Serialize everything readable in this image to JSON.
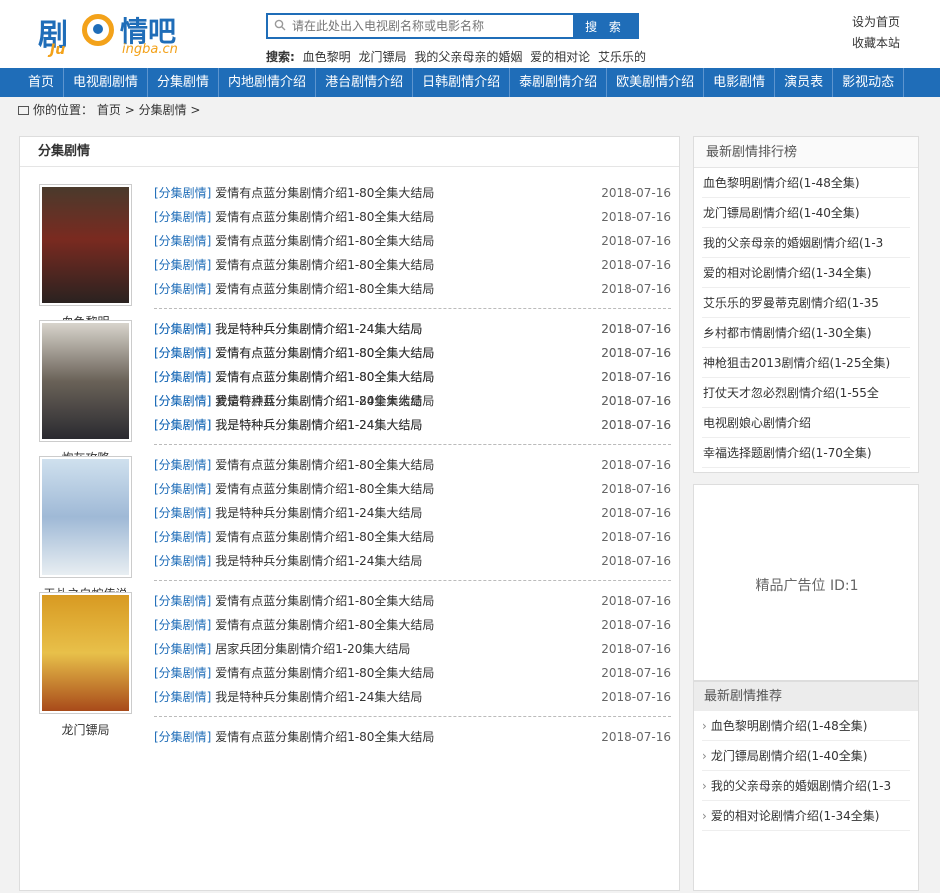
{
  "logo": {
    "char1": "剧",
    "char2": "情吧",
    "sub1": "Ju",
    "sub2": "ingba.cn"
  },
  "search": {
    "placeholder": "请在此处出入电视剧名称或电影名称",
    "button": "搜 索"
  },
  "hot": {
    "label": "搜索:",
    "items": [
      "血色黎明",
      "龙门镖局",
      "我的父亲母亲的婚姻",
      "爱的相对论",
      "艾乐乐的"
    ]
  },
  "toplinks": {
    "home": "设为首页",
    "fav": "收藏本站"
  },
  "nav": [
    "首页",
    "电视剧剧情",
    "分集剧情",
    "内地剧情介绍",
    "港台剧情介绍",
    "日韩剧情介绍",
    "泰剧剧情介绍",
    "欧美剧情介绍",
    "电影剧情",
    "演员表",
    "影视动态"
  ],
  "crumb": {
    "label": "你的位置：",
    "home": "首页",
    "sep": ">",
    "cur": "分集剧情",
    "end": ">"
  },
  "main": {
    "title": "分集剧情",
    "cat": "[分集剧情]",
    "groups": [
      {
        "name": "血色黎明",
        "rows": [
          {
            "t": "爱情有点蓝分集剧情介绍1-80全集大结局",
            "d": "2018-07-16"
          },
          {
            "t": "爱情有点蓝分集剧情介绍1-80全集大结局",
            "d": "2018-07-16"
          },
          {
            "t": "爱情有点蓝分集剧情介绍1-80全集大结局",
            "d": "2018-07-16"
          },
          {
            "t": "爱情有点蓝分集剧情介绍1-80全集大结局",
            "d": "2018-07-16"
          },
          {
            "t": "爱情有点蓝分集剧情介绍1-80全集大结局",
            "d": "2018-07-16"
          },
          {
            "t": "我是特种兵分集剧情介绍1-24集大结局",
            "d": "2018-07-16"
          },
          {
            "t": "爱情有点蓝分集剧情介绍1-80全集大结局",
            "d": "2018-07-16"
          },
          {
            "t": "爱情有点蓝分集剧情介绍1-80全集大结局",
            "d": "2018-07-16"
          },
          {
            "t": "爱情有点蓝分集剧情介绍1-80全集大结局",
            "d": "2018-07-16"
          },
          {
            "t": "我是特种兵分集剧情介绍1-24集大结局",
            "d": "2018-07-16"
          }
        ]
      },
      {
        "name": "炮灰攻略",
        "rows": [
          {
            "t": "我是特种兵分集剧情介绍1-24集大结局",
            "d": "2018-07-16"
          },
          {
            "t": "爱情有点蓝分集剧情介绍1-80全集大结局",
            "d": "2018-07-16"
          },
          {
            "t": "爱情有点蓝分集剧情介绍1-80全集大结局",
            "d": "2018-07-16"
          },
          {
            "t": "我是特种兵分集剧情介绍1-24集大结局",
            "d": "2018-07-16"
          },
          {
            "t": "我是特种兵分集剧情介绍1-24集大结局",
            "d": "2018-07-16"
          }
        ]
      },
      {
        "name": "天乩之白蛇传说",
        "rows": [
          {
            "t": "爱情有点蓝分集剧情介绍1-80全集大结局",
            "d": "2018-07-16"
          },
          {
            "t": "爱情有点蓝分集剧情介绍1-80全集大结局",
            "d": "2018-07-16"
          },
          {
            "t": "我是特种兵分集剧情介绍1-24集大结局",
            "d": "2018-07-16"
          },
          {
            "t": "爱情有点蓝分集剧情介绍1-80全集大结局",
            "d": "2018-07-16"
          },
          {
            "t": "我是特种兵分集剧情介绍1-24集大结局",
            "d": "2018-07-16"
          }
        ]
      },
      {
        "name": "龙门镖局",
        "rows": [
          {
            "t": "爱情有点蓝分集剧情介绍1-80全集大结局",
            "d": "2018-07-16"
          },
          {
            "t": "爱情有点蓝分集剧情介绍1-80全集大结局",
            "d": "2018-07-16"
          },
          {
            "t": "居家兵团分集剧情介绍1-20集大结局",
            "d": "2018-07-16"
          },
          {
            "t": "爱情有点蓝分集剧情介绍1-80全集大结局",
            "d": "2018-07-16"
          },
          {
            "t": "我是特种兵分集剧情介绍1-24集大结局",
            "d": "2018-07-16"
          },
          {
            "t": "爱情有点蓝分集剧情介绍1-80全集大结局",
            "d": "2018-07-16"
          }
        ]
      }
    ]
  },
  "rank": {
    "title": "最新剧情排行榜",
    "items": [
      "血色黎明剧情介绍(1-48全集)",
      "龙门镖局剧情介绍(1-40全集)",
      "我的父亲母亲的婚姻剧情介绍(1-3",
      "爱的相对论剧情介绍(1-34全集)",
      "艾乐乐的罗曼蒂克剧情介绍(1-35",
      "乡村都市情剧情介绍(1-30全集)",
      "神枪狙击2013剧情介绍(1-25全集)",
      "打仗天才忽必烈剧情介绍(1-55全",
      "电视剧娘心剧情介绍",
      "幸福选择题剧情介绍(1-70全集)"
    ]
  },
  "ad": {
    "text": "精品广告位 ID:1"
  },
  "rec": {
    "title": "最新剧情推荐",
    "items": [
      "血色黎明剧情介绍(1-48全集)",
      "龙门镖局剧情介绍(1-40全集)",
      "我的父亲母亲的婚姻剧情介绍(1-3",
      "爱的相对论剧情介绍(1-34全集)"
    ]
  },
  "colors": {
    "brand": "#1f6db8",
    "accent": "#f3a21a"
  }
}
